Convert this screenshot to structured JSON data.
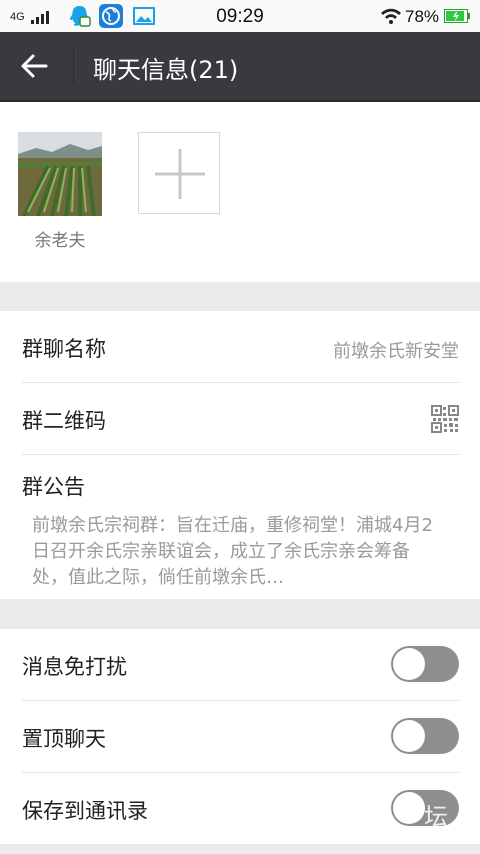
{
  "status_bar": {
    "network": "4G",
    "time": "09:29",
    "battery_percent": "78%",
    "icons": [
      "signal-icon",
      "qq-icon",
      "browser-icon",
      "gallery-icon",
      "wifi-icon",
      "battery-icon"
    ]
  },
  "header": {
    "title": "聊天信息(21)",
    "background": "#393a3f"
  },
  "members": [
    {
      "name": "余老夫"
    }
  ],
  "group": {
    "name_label": "群聊名称",
    "name_value": "前墩余氏新安堂",
    "qr_label": "群二维码",
    "notice_label": "群公告",
    "notice_text": "前墩余氏宗祠群：旨在迁庙，重修祠堂！浦城4月2日召开余氏宗亲联谊会，成立了余氏宗亲会筹备处，值此之际，倘任前墩余氏…"
  },
  "settings": {
    "mute_label": "消息免打扰",
    "mute_on": false,
    "pin_label": "置顶聊天",
    "pin_on": false,
    "save_label": "保存到通讯录",
    "save_on": false
  },
  "watermark": "坛"
}
